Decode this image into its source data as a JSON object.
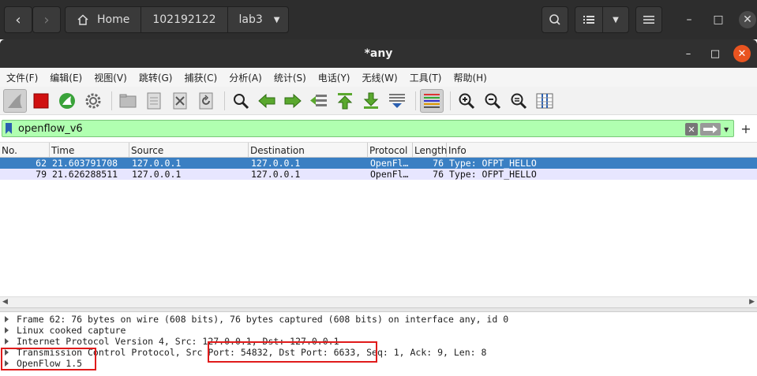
{
  "file_manager": {
    "breadcrumbs": [
      "Home",
      "102192122",
      "lab3"
    ]
  },
  "window": {
    "title": "*any"
  },
  "menu": [
    "文件(F)",
    "编辑(E)",
    "视图(V)",
    "跳转(G)",
    "捕获(C)",
    "分析(A)",
    "统计(S)",
    "电话(Y)",
    "无线(W)",
    "工具(T)",
    "帮助(H)"
  ],
  "filter": {
    "value": "openflow_v6"
  },
  "packet_list": {
    "columns": [
      "No.",
      "Time",
      "Source",
      "Destination",
      "Protocol",
      "Length",
      "Info"
    ],
    "rows": [
      {
        "no": "62",
        "time": "21.603791708",
        "source": "127.0.0.1",
        "destination": "127.0.0.1",
        "protocol": "OpenFl…",
        "length": "76",
        "info": "Type: OFPT_HELLO"
      },
      {
        "no": "79",
        "time": "21.626288511",
        "source": "127.0.0.1",
        "destination": "127.0.0.1",
        "protocol": "OpenFl…",
        "length": "76",
        "info": "Type: OFPT_HELLO"
      }
    ]
  },
  "details": [
    "Frame 62: 76 bytes on wire (608 bits), 76 bytes captured (608 bits) on interface any, id 0",
    "Linux cooked capture",
    "Internet Protocol Version 4, Src: 127.0.0.1, Dst: 127.0.0.1",
    "Transmission Control Protocol, Src Port: 54832, Dst Port: 6633, Seq: 1, Ack: 9, Len: 8",
    "OpenFlow 1.5"
  ],
  "colors": {
    "filter_valid": "#b0ffb0",
    "selected_row": "#3a7fc3",
    "highlight_box": "#e01b1b",
    "close_button": "#e95420"
  }
}
